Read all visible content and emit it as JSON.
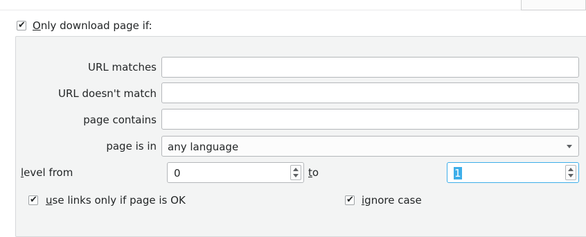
{
  "filter": {
    "enabled": true,
    "title_first": "O",
    "title_rest": "nly download page if:"
  },
  "fields": {
    "url_matches_label": "URL matches",
    "url_matches_value": "",
    "url_not_match_label": "URL doesn't match",
    "url_not_match_value": "",
    "page_contains_label": "page contains",
    "page_contains_value": "",
    "page_is_in_label": "page is in",
    "page_is_in_value": "any language"
  },
  "level": {
    "from_first": "l",
    "from_rest": "evel from",
    "from_value": "0",
    "to_first": "t",
    "to_rest": "o",
    "to_value": "1"
  },
  "options": {
    "use_links_checked": true,
    "use_links_first": "u",
    "use_links_rest": "se links only if page is OK",
    "ignore_case_checked": true,
    "ignore_case_first": "i",
    "ignore_case_rest": "gnore case"
  },
  "icons": {
    "check": "checkmark-icon",
    "dropdown": "chevron-down-icon",
    "spin_up": "spin-up-icon",
    "spin_down": "spin-down-icon"
  }
}
